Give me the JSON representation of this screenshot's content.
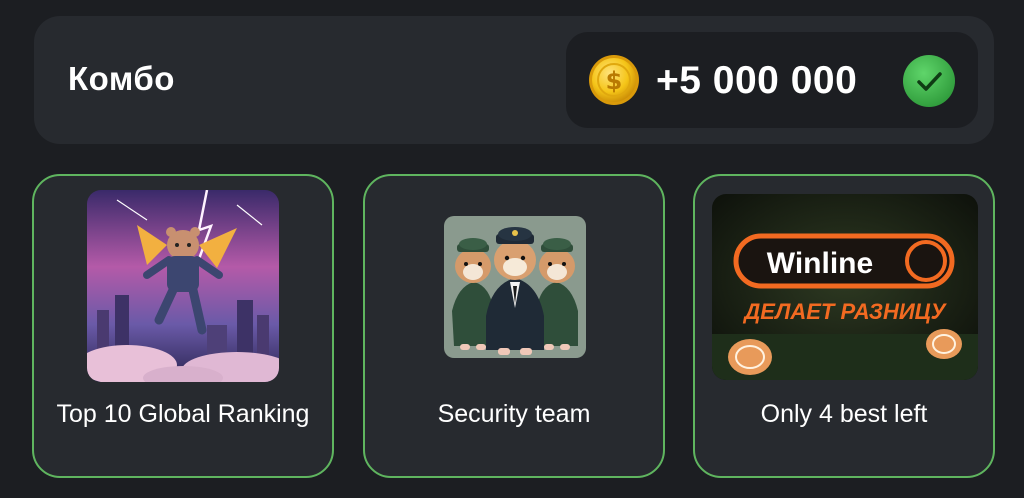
{
  "combo": {
    "title": "Комбо",
    "reward_amount": "+5 000 000",
    "coin_icon": "coin-icon",
    "status_icon": "check-icon"
  },
  "cards": [
    {
      "label": "Top 10 Global Ranking",
      "image": "hamster-jetpack-flying-image"
    },
    {
      "label": "Security team",
      "image": "hamster-security-team-image"
    },
    {
      "label": "Only 4 best left",
      "image": "winline-ad-image",
      "image_text": {
        "logo": "Winline",
        "slogan": "ДЕЛАЕТ РАЗНИЦУ"
      }
    }
  ],
  "colors": {
    "background": "#1c1e22",
    "panel": "#272a2f",
    "card_border": "#5fb55f",
    "check_green": "#3fae4a",
    "coin_gold": "#f5c518",
    "winline_orange": "#f26a21"
  }
}
